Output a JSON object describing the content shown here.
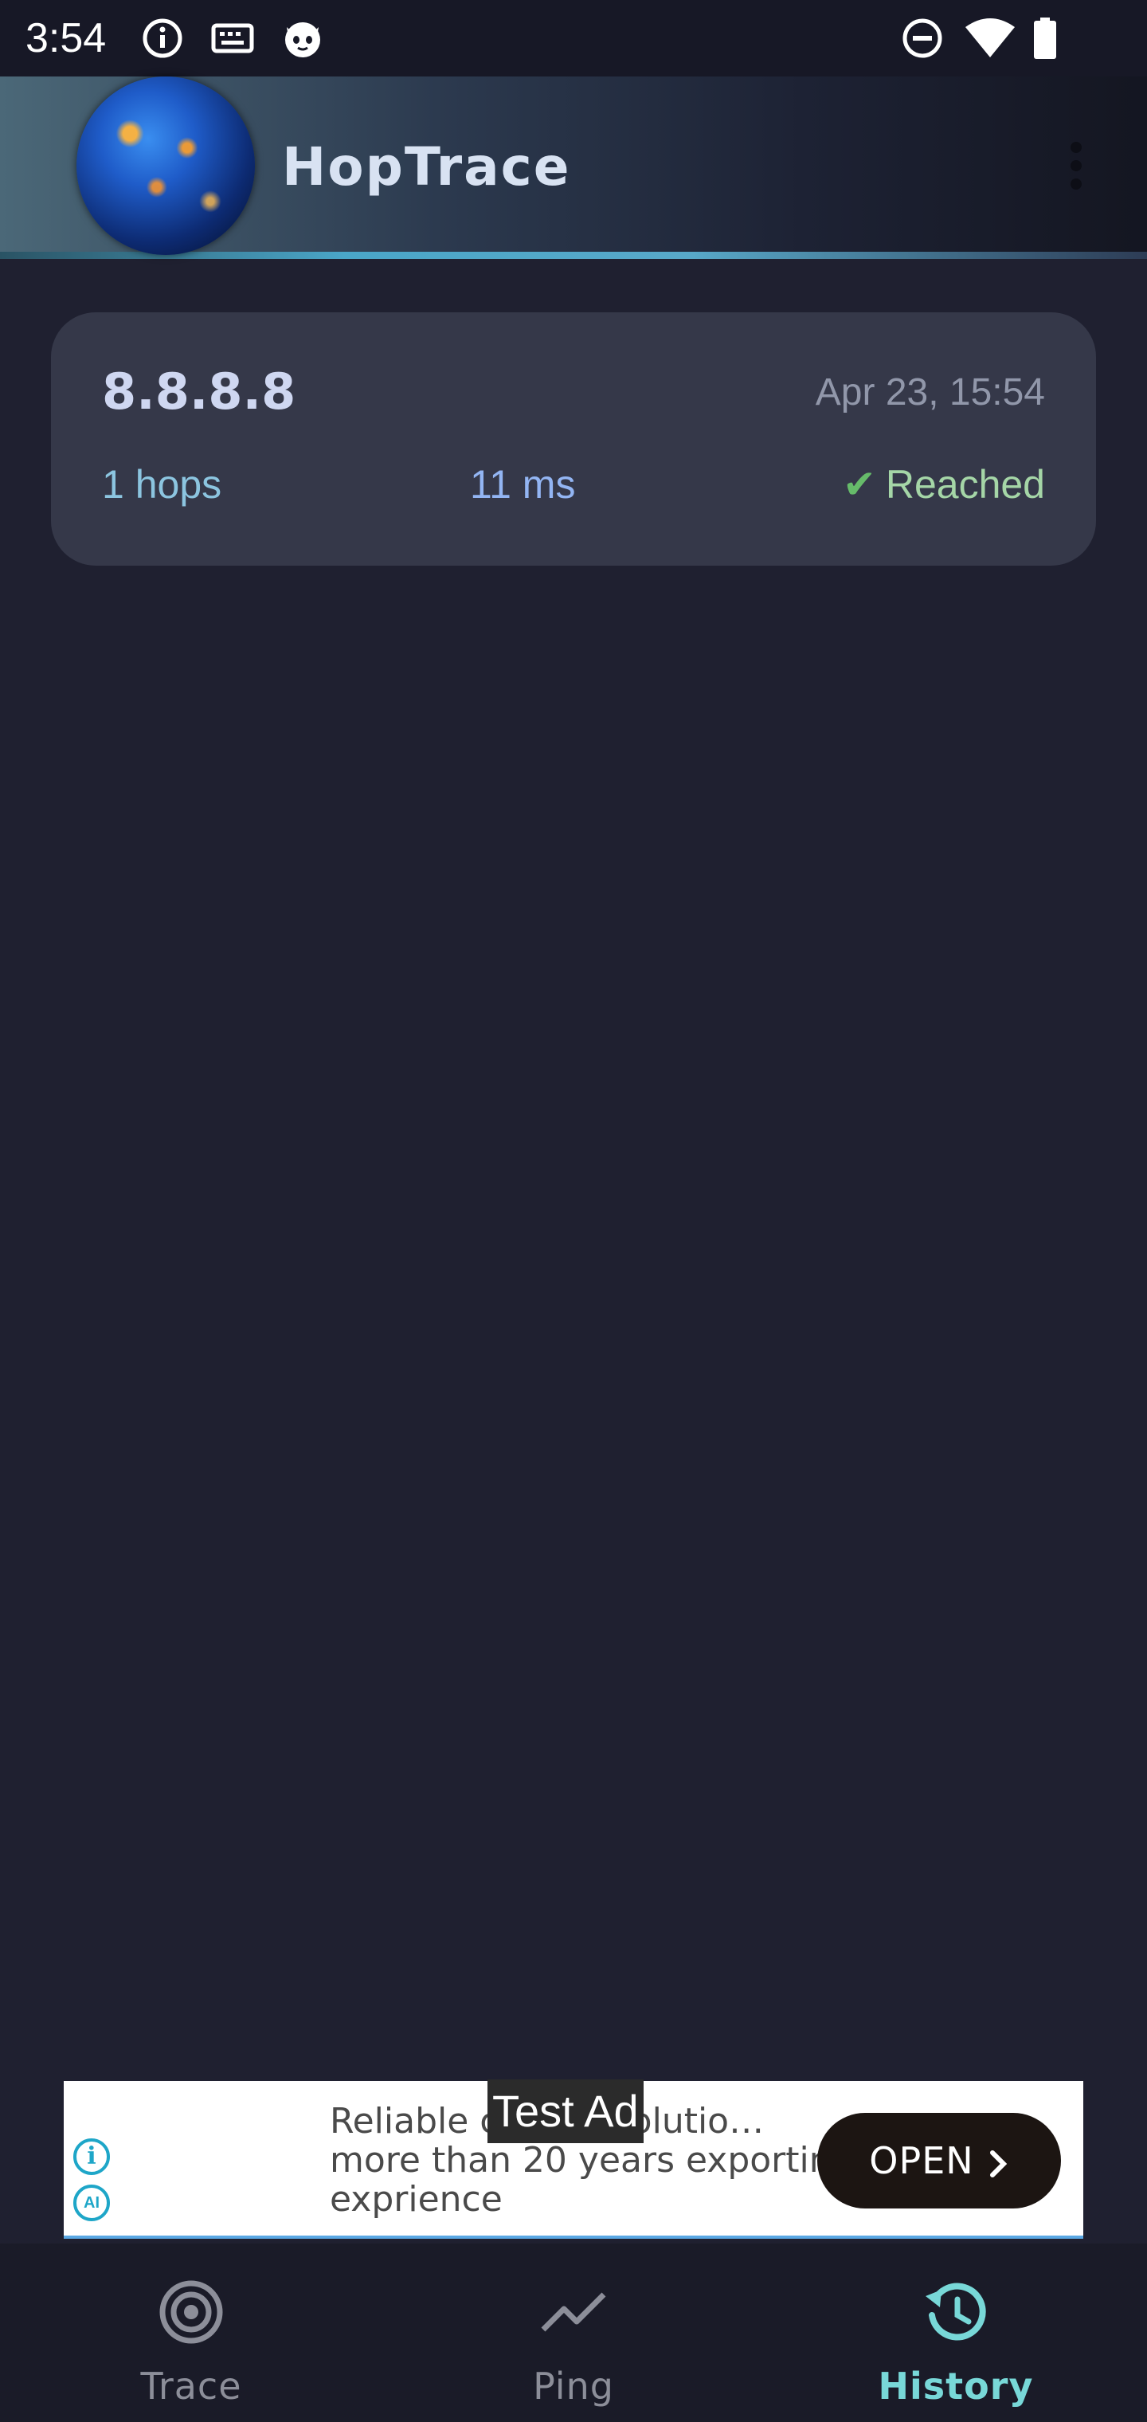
{
  "status_bar": {
    "time": "3:54",
    "left_icons": [
      "info-icon",
      "keyboard-icon",
      "cat-face-icon"
    ],
    "right_icons": [
      "do-not-disturb-icon",
      "wifi-icon",
      "battery-icon"
    ]
  },
  "app_bar": {
    "title": "HopTrace",
    "logo": "globe-network-image",
    "menu_icon": "more-vert-icon"
  },
  "history": [
    {
      "host": "8.8.8.8",
      "date": "Apr 23, 15:54",
      "hops": "1 hops",
      "latency": "11 ms",
      "status": "Reached",
      "status_color": "#a5d6a7"
    }
  ],
  "ad": {
    "badge": "Test Ad",
    "text": "Reliable c…tion solutio…\nmore than 20 years exporting\nexprience",
    "button": "OPEN"
  },
  "bottom_nav": {
    "items": [
      {
        "label": "Trace",
        "icon": "target-icon",
        "active": false
      },
      {
        "label": "Ping",
        "icon": "trend-line-icon",
        "active": false
      },
      {
        "label": "History",
        "icon": "history-icon",
        "active": true
      }
    ],
    "active_color": "#78d8d8"
  }
}
